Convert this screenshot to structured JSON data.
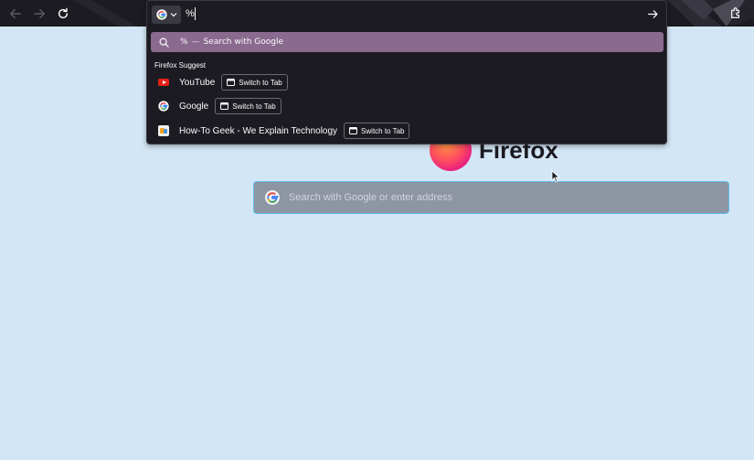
{
  "urlbar": {
    "value": "%",
    "highlight": {
      "query": "%",
      "separator": "—",
      "action": "Search with Google"
    },
    "group_label": "Firefox Suggest",
    "suggestions": [
      {
        "title": "YouTube",
        "favicon": "youtube-favicon",
        "action_label": "Switch to Tab"
      },
      {
        "title": "Google",
        "favicon": "google-favicon",
        "action_label": "Switch to Tab"
      },
      {
        "title": "How-To Geek - We Explain Technology",
        "favicon": "howtogeek-favicon",
        "action_label": "Switch to Tab"
      }
    ]
  },
  "new_tab": {
    "logo_text": "Firefox",
    "search_placeholder": "Search with Google or enter address"
  },
  "colors": {
    "toolbar_bg": "#1c1b22",
    "page_bg": "#d3e6f5",
    "highlight": "#8a6a8e",
    "search_box": "#8e95a3",
    "focus_ring": "#5dc1ee"
  },
  "icons": {
    "back": "back-arrow-icon",
    "forward": "forward-arrow-icon",
    "reload": "reload-icon",
    "go": "go-arrow-icon",
    "extensions": "extensions-icon",
    "search": "search-icon",
    "engine": "google-icon",
    "tab": "tab-icon"
  }
}
